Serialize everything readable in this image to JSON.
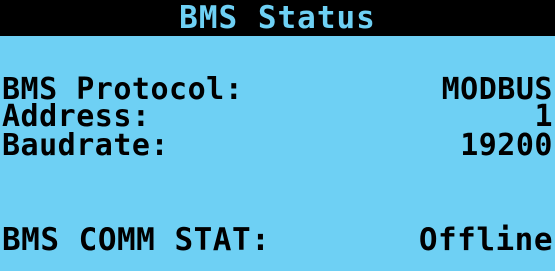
{
  "header": {
    "title": "BMS Status"
  },
  "status": {
    "protocol_label": "BMS Protocol:",
    "protocol_value": "MODBUS",
    "address_label": "Address:",
    "address_value": "1",
    "baudrate_label": "Baudrate:",
    "baudrate_value": "19200",
    "comm_label": "BMS COMM STAT:",
    "comm_value": "Offline"
  },
  "colors": {
    "screen_background": "#6ed0f4",
    "header_background": "#000000",
    "text": "#000000"
  }
}
